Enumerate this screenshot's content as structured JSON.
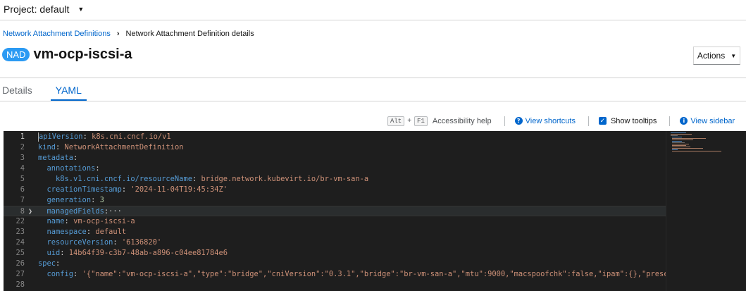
{
  "project": {
    "label": "Project: default"
  },
  "breadcrumb": {
    "parent": "Network Attachment Definitions",
    "current": "Network Attachment Definition details"
  },
  "resource": {
    "badge": "NAD",
    "name": "vm-ocp-iscsi-a"
  },
  "actions": {
    "label": "Actions"
  },
  "tabs": [
    {
      "label": "Details"
    },
    {
      "label": "YAML"
    }
  ],
  "toolbar": {
    "key1": "Alt",
    "plus": "+",
    "key2": "F1",
    "accessibility": "Accessibility help",
    "shortcuts": "View shortcuts",
    "tooltips": "Show tooltips",
    "sidebar": "View sidebar"
  },
  "editor": {
    "lines": [
      {
        "num": "1",
        "tokens": [
          {
            "t": "apiVersion",
            "c": "k"
          },
          {
            "t": ": ",
            "c": "p"
          },
          {
            "t": "k8s.cni.cncf.io/v1",
            "c": "s"
          }
        ]
      },
      {
        "num": "2",
        "tokens": [
          {
            "t": "kind",
            "c": "k"
          },
          {
            "t": ": ",
            "c": "p"
          },
          {
            "t": "NetworkAttachmentDefinition",
            "c": "s"
          }
        ]
      },
      {
        "num": "3",
        "tokens": [
          {
            "t": "metadata",
            "c": "k"
          },
          {
            "t": ":",
            "c": "p"
          }
        ]
      },
      {
        "num": "4",
        "tokens": [
          {
            "t": "  annotations",
            "c": "k"
          },
          {
            "t": ":",
            "c": "p"
          }
        ]
      },
      {
        "num": "5",
        "tokens": [
          {
            "t": "    k8s.v1.cni.cncf.io/resourceName",
            "c": "k"
          },
          {
            "t": ": ",
            "c": "p"
          },
          {
            "t": "bridge.network.kubevirt.io/br-vm-san-a",
            "c": "s"
          }
        ]
      },
      {
        "num": "6",
        "tokens": [
          {
            "t": "  creationTimestamp",
            "c": "k"
          },
          {
            "t": ": ",
            "c": "p"
          },
          {
            "t": "'2024-11-04T19:45:34Z'",
            "c": "s"
          }
        ]
      },
      {
        "num": "7",
        "tokens": [
          {
            "t": "  generation",
            "c": "k"
          },
          {
            "t": ": ",
            "c": "p"
          },
          {
            "t": "3",
            "c": "n"
          }
        ]
      },
      {
        "num": "8",
        "tokens": [
          {
            "t": "  managedFields",
            "c": "k"
          },
          {
            "t": ":···",
            "c": "p"
          }
        ],
        "folded": true
      },
      {
        "num": "22",
        "tokens": [
          {
            "t": "  name",
            "c": "k"
          },
          {
            "t": ": ",
            "c": "p"
          },
          {
            "t": "vm-ocp-iscsi-a",
            "c": "s"
          }
        ]
      },
      {
        "num": "23",
        "tokens": [
          {
            "t": "  namespace",
            "c": "k"
          },
          {
            "t": ": ",
            "c": "p"
          },
          {
            "t": "default",
            "c": "s"
          }
        ]
      },
      {
        "num": "24",
        "tokens": [
          {
            "t": "  resourceVersion",
            "c": "k"
          },
          {
            "t": ": ",
            "c": "p"
          },
          {
            "t": "'6136820'",
            "c": "s"
          }
        ]
      },
      {
        "num": "25",
        "tokens": [
          {
            "t": "  uid",
            "c": "k"
          },
          {
            "t": ": ",
            "c": "p"
          },
          {
            "t": "14b64f39-c3b7-48ab-a896-c04ee81784e6",
            "c": "s"
          }
        ]
      },
      {
        "num": "26",
        "tokens": [
          {
            "t": "spec",
            "c": "k"
          },
          {
            "t": ":",
            "c": "p"
          }
        ]
      },
      {
        "num": "27",
        "tokens": [
          {
            "t": "  config",
            "c": "k"
          },
          {
            "t": ": ",
            "c": "p"
          },
          {
            "t": "'{\"name\":\"vm-ocp-iscsi-a\",\"type\":\"bridge\",\"cniVersion\":\"0.3.1\",\"bridge\":\"br-vm-san-a\",\"mtu\":9000,\"macspoofchk\":false,\"ipam\":{},\"preserveDe",
            "c": "s"
          }
        ]
      },
      {
        "num": "28",
        "tokens": []
      }
    ]
  },
  "colors": {
    "link": "#0066cc",
    "badge": "#2b9af3",
    "editor_bg": "#1e1e1e",
    "key": "#569cd6",
    "string": "#ce9178",
    "number": "#b5cea8"
  },
  "icons": {
    "project_caret": "caret-down-icon",
    "actions_caret": "caret-down-icon",
    "shortcuts": "question-circle-icon",
    "sidebar": "info-circle-icon",
    "fold": "chevron-right-icon"
  }
}
